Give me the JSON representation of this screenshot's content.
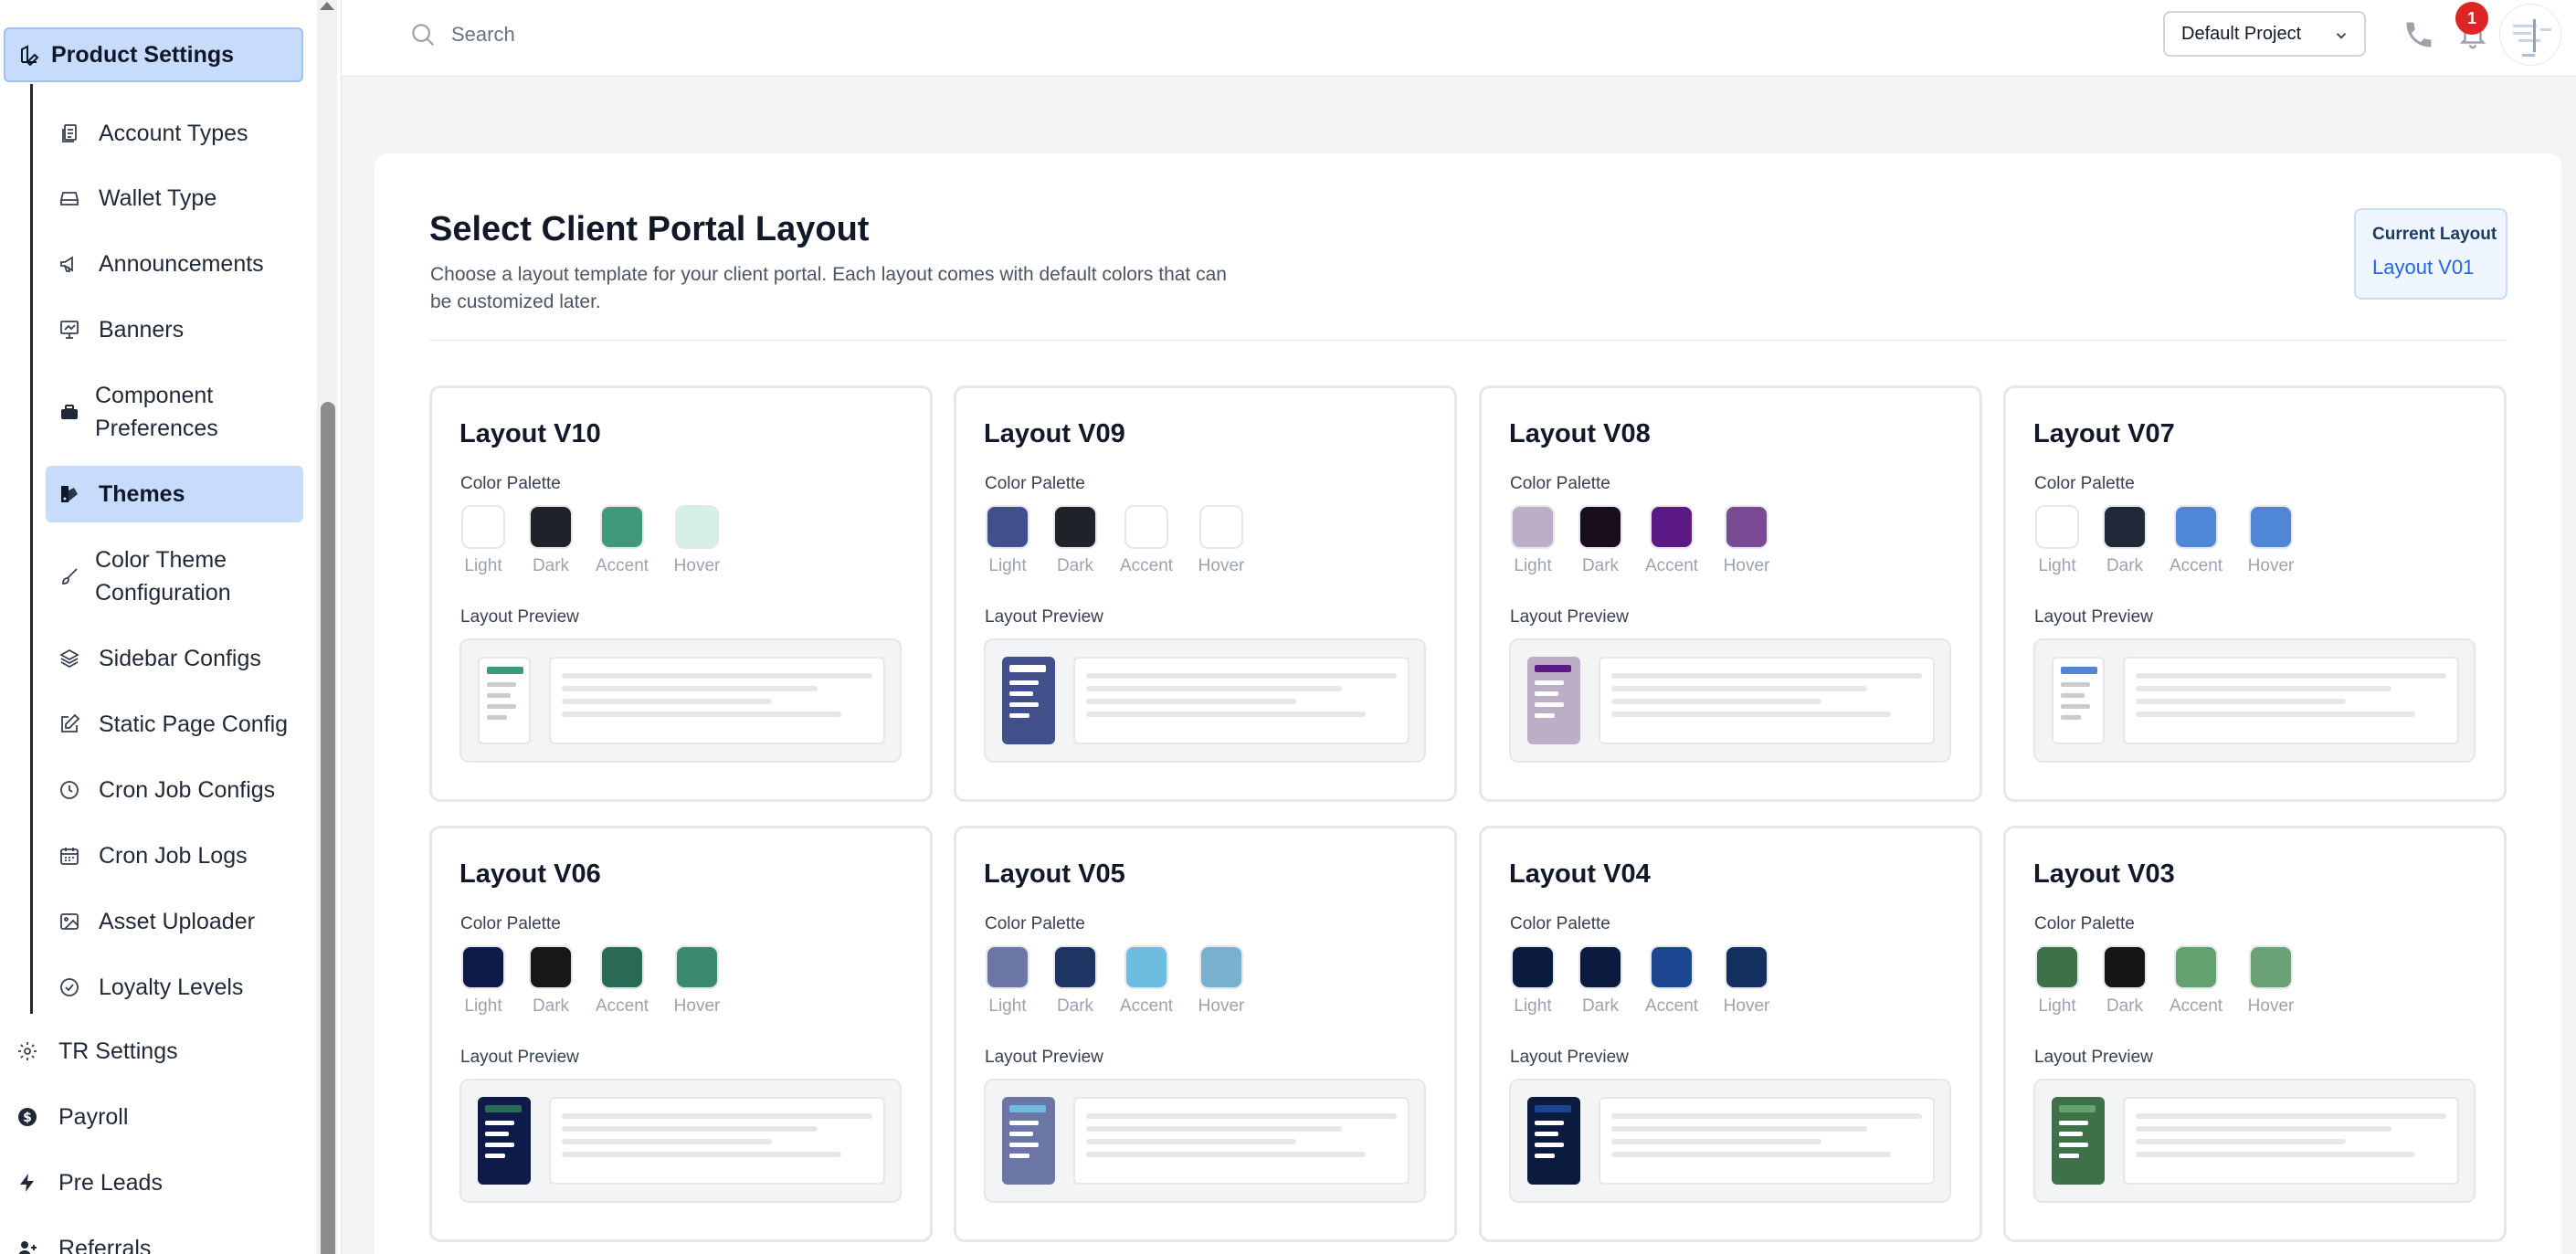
{
  "sidebar": {
    "section_title": "Product Settings",
    "items": [
      {
        "label": "Account Types",
        "icon": "document-stack-icon"
      },
      {
        "label": "Wallet Type",
        "icon": "wallet-icon"
      },
      {
        "label": "Announcements",
        "icon": "megaphone-icon"
      },
      {
        "label": "Banners",
        "icon": "presentation-icon"
      },
      {
        "label": "Component Preferences",
        "icon": "toolbox-icon"
      },
      {
        "label": "Themes",
        "icon": "palette-icon",
        "active": true
      },
      {
        "label": "Color Theme Configuration",
        "icon": "brush-icon"
      },
      {
        "label": "Sidebar Configs",
        "icon": "layers-icon"
      },
      {
        "label": "Static Page Config",
        "icon": "edit-icon"
      },
      {
        "label": "Cron Job Configs",
        "icon": "clock-icon"
      },
      {
        "label": "Cron Job Logs",
        "icon": "calendar-icon"
      },
      {
        "label": "Asset Uploader",
        "icon": "image-icon"
      },
      {
        "label": "Loyalty Levels",
        "icon": "check-circle-icon"
      }
    ],
    "top_items": [
      {
        "label": "TR Settings",
        "icon": "gear-icon"
      },
      {
        "label": "Payroll",
        "icon": "dollar-circle-icon"
      },
      {
        "label": "Pre Leads",
        "icon": "lightning-icon"
      },
      {
        "label": "Referrals",
        "icon": "user-plus-icon"
      }
    ]
  },
  "topbar": {
    "search_placeholder": "Search",
    "project": "Default Project",
    "notification_count": "1"
  },
  "main": {
    "title": "Select Client Portal Layout",
    "subtitle": "Choose a layout template for your client portal. Each layout comes with default colors that can be customized later.",
    "current_layout_label": "Current Layout",
    "current_layout_value": "Layout V01",
    "color_palette_label": "Color Palette",
    "layout_preview_label": "Layout Preview",
    "swatch_names": [
      "Light",
      "Dark",
      "Accent",
      "Hover"
    ],
    "layouts": [
      {
        "name": "Layout V10",
        "colors": [
          "#ffffff",
          "#1f2329",
          "#3f9a7c",
          "#d4f0e8"
        ],
        "preview_sidebar": "#ffffff",
        "preview_accent": "#3f9a7c",
        "preview_lines": "#c8cbd0"
      },
      {
        "name": "Layout V09",
        "colors": [
          "#414f8a",
          "#1f2329",
          "#ffffff",
          "#ffffff"
        ],
        "preview_sidebar": "#414f8a",
        "preview_accent": "#ffffff",
        "preview_lines": "#ffffff"
      },
      {
        "name": "Layout V08",
        "colors": [
          "#bdaec8",
          "#180d1d",
          "#5c1a87",
          "#7a4b95"
        ],
        "preview_sidebar": "#bdaec8",
        "preview_accent": "#5c1a87",
        "preview_lines": "#ffffff"
      },
      {
        "name": "Layout V07",
        "colors": [
          "#ffffff",
          "#1f2937",
          "#4f86d6",
          "#4f86d6"
        ],
        "preview_sidebar": "#ffffff",
        "preview_accent": "#4f86d6",
        "preview_lines": "#c8cbd0"
      },
      {
        "name": "Layout V06",
        "colors": [
          "#0d1a4a",
          "#151719",
          "#2c6a58",
          "#3a8a70"
        ],
        "preview_sidebar": "#0d1a4a",
        "preview_accent": "#2c6a58",
        "preview_lines": "#ffffff"
      },
      {
        "name": "Layout V05",
        "colors": [
          "#6b76a6",
          "#1e3462",
          "#6dbde0",
          "#78b1cf"
        ],
        "preview_sidebar": "#6b76a6",
        "preview_accent": "#6dbde0",
        "preview_lines": "#ffffff"
      },
      {
        "name": "Layout V04",
        "colors": [
          "#0b1a3f",
          "#0c1a3d",
          "#1d4690",
          "#14305f"
        ],
        "preview_sidebar": "#0b1a3f",
        "preview_accent": "#1d4690",
        "preview_lines": "#ffffff"
      },
      {
        "name": "Layout V03",
        "colors": [
          "#3f7149",
          "#151715",
          "#63a16f",
          "#6aa276"
        ],
        "preview_sidebar": "#3f7149",
        "preview_accent": "#63a16f",
        "preview_lines": "#ffffff"
      }
    ]
  }
}
